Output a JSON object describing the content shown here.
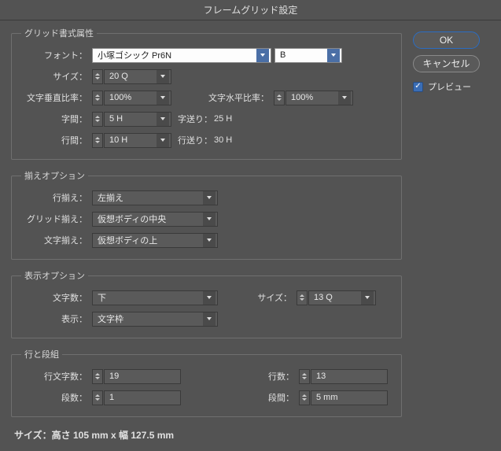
{
  "title": "フレームグリッド設定",
  "buttons": {
    "ok": "OK",
    "cancel": "キャンセル"
  },
  "preview": {
    "label": "プレビュー",
    "checked": true
  },
  "grid_attrs": {
    "legend": "グリッド書式属性",
    "font_label": "フォント：",
    "font_family": "小塚ゴシック Pr6N",
    "font_style": "B",
    "size_label": "サイズ：",
    "size": "20 Q",
    "vscale_label": "文字垂直比率：",
    "vscale": "100%",
    "hscale_label": "文字水平比率：",
    "hscale": "100%",
    "char_aki_label": "字間：",
    "char_aki": "5 H",
    "char_okuri_label": "字送り：",
    "char_okuri": "25 H",
    "line_aki_label": "行間：",
    "line_aki": "10 H",
    "line_okuri_label": "行送り：",
    "line_okuri": "30 H"
  },
  "align_opts": {
    "legend": "揃えオプション",
    "line_align_label": "行揃え：",
    "line_align": "左揃え",
    "grid_align_label": "グリッド揃え：",
    "grid_align": "仮想ボディの中央",
    "char_align_label": "文字揃え：",
    "char_align": "仮想ボディの上"
  },
  "view_opts": {
    "legend": "表示オプション",
    "char_count_label": "文字数：",
    "char_count": "下",
    "size_label": "サイズ：",
    "size": "13 Q",
    "view_label": "表示：",
    "view": "文字枠"
  },
  "rows_cols": {
    "legend": "行と段組",
    "chars_per_line_label": "行文字数：",
    "chars_per_line": "19",
    "lines_label": "行数：",
    "lines": "13",
    "cols_label": "段数：",
    "cols": "1",
    "gutter_label": "段間：",
    "gutter": "5 mm"
  },
  "footer": "サイズ：高さ 105 mm x 幅 127.5 mm"
}
